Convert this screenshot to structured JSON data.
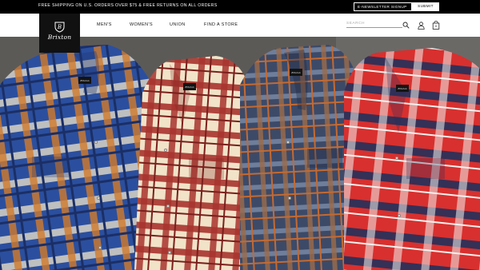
{
  "topbar": {
    "promo": "FREE SHIPPING ON U.S. ORDERS OVER $75 & FREE RETURNS ON ALL ORDERS",
    "newsletter_label": "E-NEWSLETTER SIGNUP",
    "submit_label": "SUBMIT"
  },
  "brand": {
    "logo_text": "Brixton"
  },
  "nav": {
    "items": [
      {
        "label": "MEN'S"
      },
      {
        "label": "WOMEN'S"
      },
      {
        "label": "UNION"
      },
      {
        "label": "FIND A STORE"
      }
    ]
  },
  "search": {
    "placeholder": "SEARCH"
  },
  "cart": {
    "count": "0"
  },
  "hero": {
    "shirt_labels": [
      "Brixton",
      "Brixton",
      "Brixton",
      "Brixton"
    ],
    "colors": {
      "blue_flannel": "#2b4f9e",
      "red_cream_flannel": "#a8342e",
      "navy_plaid_flannel": "#3c4a68",
      "red_flannel": "#d8302e",
      "background": "#5c5a57"
    }
  },
  "icons": {
    "search": "search-icon",
    "account": "user-icon",
    "cart": "shopping-bag-icon",
    "logo_crest": "shield-icon"
  }
}
